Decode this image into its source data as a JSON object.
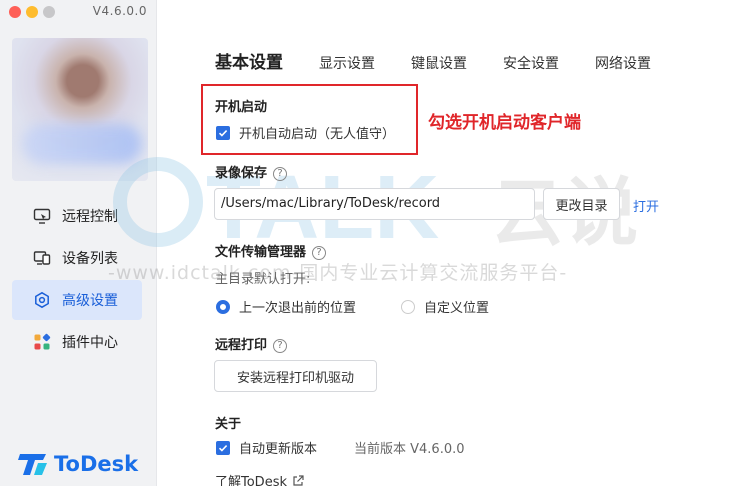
{
  "app": {
    "version": "V4.6.0.0",
    "logo_text": "ToDesk"
  },
  "sidebar": {
    "items": [
      {
        "label": "远程控制",
        "icon": "remote-control-icon",
        "active": false
      },
      {
        "label": "设备列表",
        "icon": "device-list-icon",
        "active": false
      },
      {
        "label": "高级设置",
        "icon": "hexagon-settings-icon",
        "active": true
      },
      {
        "label": "插件中心",
        "icon": "plugin-icon",
        "active": false
      }
    ]
  },
  "tabs": [
    {
      "label": "基本设置",
      "active": true
    },
    {
      "label": "显示设置",
      "active": false
    },
    {
      "label": "键鼠设置",
      "active": false
    },
    {
      "label": "安全设置",
      "active": false
    },
    {
      "label": "网络设置",
      "active": false
    }
  ],
  "startup": {
    "title": "开机启动",
    "checkbox_label": "开机自动启动（无人值守）",
    "checked": true
  },
  "annotation": "勾选开机启动客户端",
  "recording": {
    "title": "录像保存",
    "path": "/Users/mac/Library/ToDesk/record",
    "change_dir_label": "更改目录",
    "open_label": "打开"
  },
  "file_transfer": {
    "title": "文件传输管理器",
    "default_open_label": "主目录默认打开:",
    "options": [
      "上一次退出前的位置",
      "自定义位置"
    ],
    "selected_index": 0
  },
  "remote_print": {
    "title": "远程打印",
    "install_label": "安装远程打印机驱动"
  },
  "about": {
    "title": "关于",
    "auto_update_label": "自动更新版本",
    "auto_update_checked": true,
    "current_version_label": "当前版本 V4.6.0.0",
    "learn_more_label": "了解ToDesk"
  },
  "watermark": {
    "text": "-www.idctalk.com-国内专业云计算交流服务平台-",
    "brand": "TALK 云说"
  },
  "colors": {
    "accent": "#2b6ee0",
    "annotation_red": "#e0262a",
    "active_nav_bg": "#dbe6fb"
  }
}
